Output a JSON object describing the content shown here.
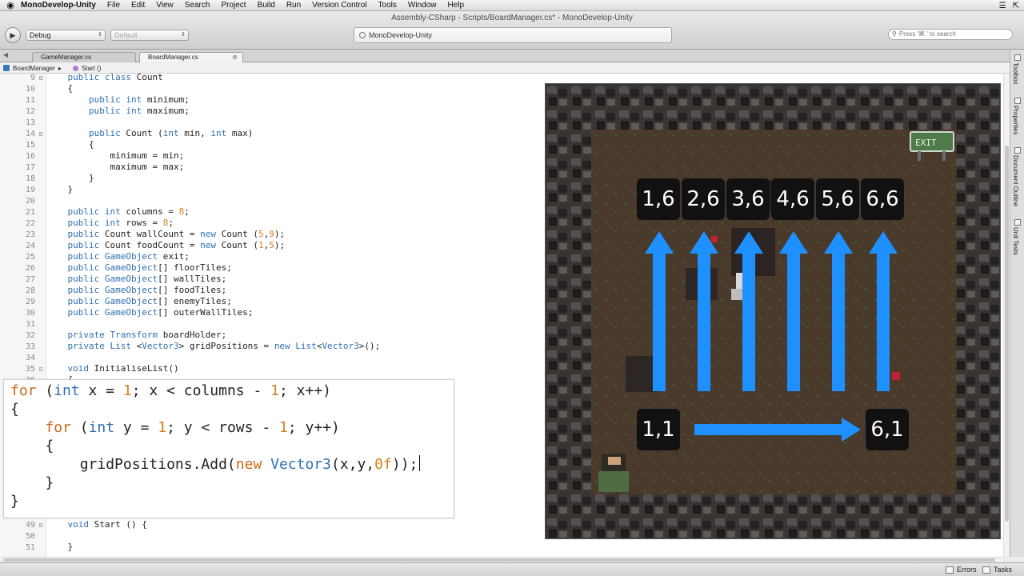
{
  "menubar": {
    "app_name": "MonoDevelop-Unity",
    "items": [
      "File",
      "Edit",
      "View",
      "Search",
      "Project",
      "Build",
      "Run",
      "Version Control",
      "Tools",
      "Window",
      "Help"
    ]
  },
  "window": {
    "title": "Assembly-CSharp - Scripts/BoardManager.cs* - MonoDevelop-Unity"
  },
  "toolbar": {
    "config": "Debug",
    "platform": "Default",
    "status": "MonoDevelop-Unity",
    "search_placeholder": "Press '⌘.' to search"
  },
  "tabs": [
    {
      "label": "GameManager.cs",
      "active": false
    },
    {
      "label": "BoardManager.cs",
      "active": true
    }
  ],
  "breadcrumb": {
    "class_name": "BoardManager",
    "method": "Start ()"
  },
  "code_lines": [
    {
      "n": "9",
      "fold": "⊟",
      "html": "    <span class=\"kw\">public</span> <span class=\"kw\">class</span> Count"
    },
    {
      "n": "10",
      "fold": "",
      "html": "    {"
    },
    {
      "n": "11",
      "fold": "",
      "html": "        <span class=\"kw\">public</span> <span class=\"tp\">int</span> minimum;"
    },
    {
      "n": "12",
      "fold": "",
      "html": "        <span class=\"kw\">public</span> <span class=\"tp\">int</span> maximum;"
    },
    {
      "n": "13",
      "fold": "",
      "html": ""
    },
    {
      "n": "14",
      "fold": "⊟",
      "html": "        <span class=\"kw\">public</span> Count (<span class=\"tp\">int</span> min, <span class=\"tp\">int</span> max)"
    },
    {
      "n": "15",
      "fold": "",
      "html": "        {"
    },
    {
      "n": "16",
      "fold": "",
      "html": "            minimum = min;"
    },
    {
      "n": "17",
      "fold": "",
      "html": "            maximum = max;"
    },
    {
      "n": "18",
      "fold": "",
      "html": "        }"
    },
    {
      "n": "19",
      "fold": "",
      "html": "    }"
    },
    {
      "n": "20",
      "fold": "",
      "html": ""
    },
    {
      "n": "21",
      "fold": "",
      "html": "    <span class=\"kw\">public</span> <span class=\"tp\">int</span> columns = <span class=\"num\">8</span>;"
    },
    {
      "n": "22",
      "fold": "",
      "html": "    <span class=\"kw\">public</span> <span class=\"tp\">int</span> rows = <span class=\"num\">8</span>;"
    },
    {
      "n": "23",
      "fold": "",
      "html": "    <span class=\"kw\">public</span> Count wallCount = <span class=\"kw\">new</span> Count (<span class=\"num\">5</span>,<span class=\"num\">9</span>);"
    },
    {
      "n": "24",
      "fold": "",
      "html": "    <span class=\"kw\">public</span> Count foodCount = <span class=\"kw\">new</span> Count (<span class=\"num\">1</span>,<span class=\"num\">5</span>);"
    },
    {
      "n": "25",
      "fold": "",
      "html": "    <span class=\"kw\">public</span> <span class=\"tp\">GameObject</span> exit;"
    },
    {
      "n": "26",
      "fold": "",
      "html": "    <span class=\"kw\">public</span> <span class=\"tp\">GameObject</span>[] floorTiles;"
    },
    {
      "n": "27",
      "fold": "",
      "html": "    <span class=\"kw\">public</span> <span class=\"tp\">GameObject</span>[] wallTiles;"
    },
    {
      "n": "28",
      "fold": "",
      "html": "    <span class=\"kw\">public</span> <span class=\"tp\">GameObject</span>[] foodTiles;"
    },
    {
      "n": "29",
      "fold": "",
      "html": "    <span class=\"kw\">public</span> <span class=\"tp\">GameObject</span>[] enemyTiles;"
    },
    {
      "n": "30",
      "fold": "",
      "html": "    <span class=\"kw\">public</span> <span class=\"tp\">GameObject</span>[] outerWallTiles;"
    },
    {
      "n": "31",
      "fold": "",
      "html": ""
    },
    {
      "n": "32",
      "fold": "",
      "html": "    <span class=\"kw\">private</span> <span class=\"tp\">Transform</span> boardHolder;"
    },
    {
      "n": "33",
      "fold": "",
      "html": "    <span class=\"kw\">private</span> <span class=\"tp\">List</span> &lt;<span class=\"tp\">Vector3</span>&gt; gridPositions = <span class=\"kw\">new</span> <span class=\"tp\">List</span>&lt;<span class=\"tp\">Vector3</span>&gt;();"
    },
    {
      "n": "34",
      "fold": "",
      "html": ""
    },
    {
      "n": "35",
      "fold": "⊟",
      "html": "    <span class=\"kw\">void</span> InitialiseList()"
    },
    {
      "n": "36",
      "fold": "",
      "html": "    {"
    }
  ],
  "code_lines_bottom": [
    {
      "n": "49",
      "fold": "⊟",
      "html": "    <span class=\"kw\">void</span> Start () {"
    },
    {
      "n": "50",
      "fold": "",
      "html": ""
    },
    {
      "n": "51",
      "fold": "",
      "html": "    }"
    }
  ],
  "overlay_lines": [
    "<span class=\"kw\">for</span> (<span class=\"tp\">int</span> x = <span class=\"num\">1</span>; x &lt; columns - <span class=\"num\">1</span>; x++)",
    "{",
    "    <span class=\"kw\">for</span> (<span class=\"tp\">int</span> y = <span class=\"num\">1</span>; y &lt; rows - <span class=\"num\">1</span>; y++)",
    "    {",
    "        gridPositions.Add(<span class=\"kw\">new</span> <span class=\"cls\">Vector3</span>(x,y,<span class=\"num\">0f</span>));<span class=\"caret\"></span>",
    "    }",
    "}"
  ],
  "game": {
    "top_labels": [
      "1,6",
      "2,6",
      "3,6",
      "4,6",
      "5,6",
      "6,6"
    ],
    "bottom_left_label": "1,1",
    "bottom_right_label": "6,1",
    "exit_sign": "EXIT",
    "arrow_color": "#1e90ff",
    "floor_color": "#4a3a2c",
    "wall_color": "#2a2626"
  },
  "right_dock": [
    "Toolbox",
    "Properties",
    "Document Outline",
    "Unit Tests"
  ],
  "statusbar": {
    "errors": "Errors",
    "tasks": "Tasks"
  }
}
